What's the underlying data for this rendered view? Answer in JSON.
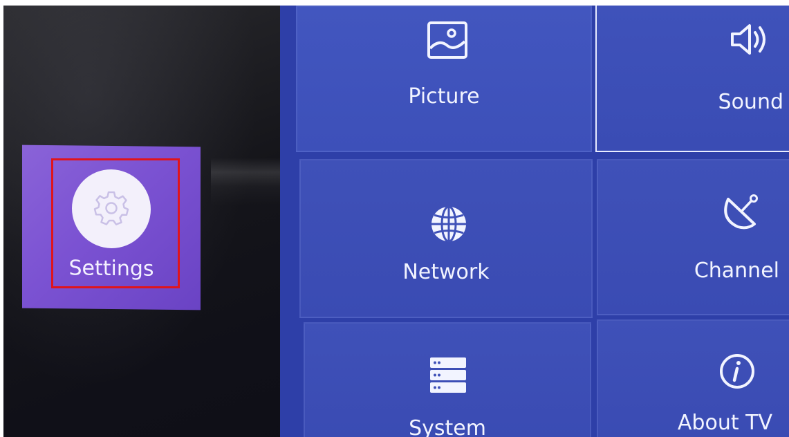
{
  "sidebar": {
    "settings_label": "Settings",
    "settings_icon": "gear-icon"
  },
  "menu": {
    "items": [
      {
        "label": "Picture",
        "icon": "picture-icon"
      },
      {
        "label": "Sound",
        "icon": "speaker-icon"
      },
      {
        "label": "Network",
        "icon": "globe-icon"
      },
      {
        "label": "Channel",
        "icon": "satellite-dish-icon"
      },
      {
        "label": "System",
        "icon": "server-icon"
      },
      {
        "label": "About TV",
        "icon": "info-icon"
      }
    ],
    "focused": "Sound"
  },
  "colors": {
    "settings_tile": "#7b52d2",
    "menu_tile": "#3f51b8",
    "highlight": "#e0141b"
  }
}
